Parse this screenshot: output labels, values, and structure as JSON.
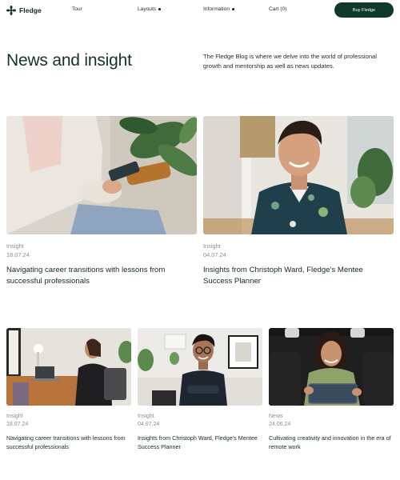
{
  "nav": {
    "logo_text": "Fledge",
    "links": [
      {
        "label": "Tour",
        "has_dot": false
      },
      {
        "label": "Layouts",
        "has_dot": true
      },
      {
        "label": "Information",
        "has_dot": true
      },
      {
        "label": "Cart (0)",
        "has_dot": false
      }
    ],
    "cta_label": "Buy Fledge"
  },
  "hero": {
    "title": "News and insight",
    "description": "The Fledge Blog is where we delve into the world of professional growth and mentorship as well as news updates."
  },
  "featured": [
    {
      "category": "Insight",
      "date": "18.07.24",
      "title": "Navigating career transitions with lessons from successful professionals",
      "image": "person-with-phone"
    },
    {
      "category": "Insight",
      "date": "04.07.24",
      "title": "Insights from Christoph Ward, Fledge's Mentee Success Planner",
      "image": "smiling-man-floral-shirt"
    }
  ],
  "grid": [
    {
      "category": "Insight",
      "date": "18.07.24",
      "title": "Navigating career transitions with lessons from successful professionals",
      "image": "woman-at-desk-laptop"
    },
    {
      "category": "Insight",
      "date": "04.07.24",
      "title": "Insights from Christoph Ward, Fledge's Mentee Success Planner",
      "image": "man-glasses-arms-crossed"
    },
    {
      "category": "News",
      "date": "24.06.24",
      "title": "Cultivating creativity and innovation in the era of remote work",
      "image": "woman-with-tablet"
    }
  ],
  "colors": {
    "brand_dark": "#0f3a29",
    "muted_text": "#8a8f8c",
    "heading_text": "#163326"
  }
}
